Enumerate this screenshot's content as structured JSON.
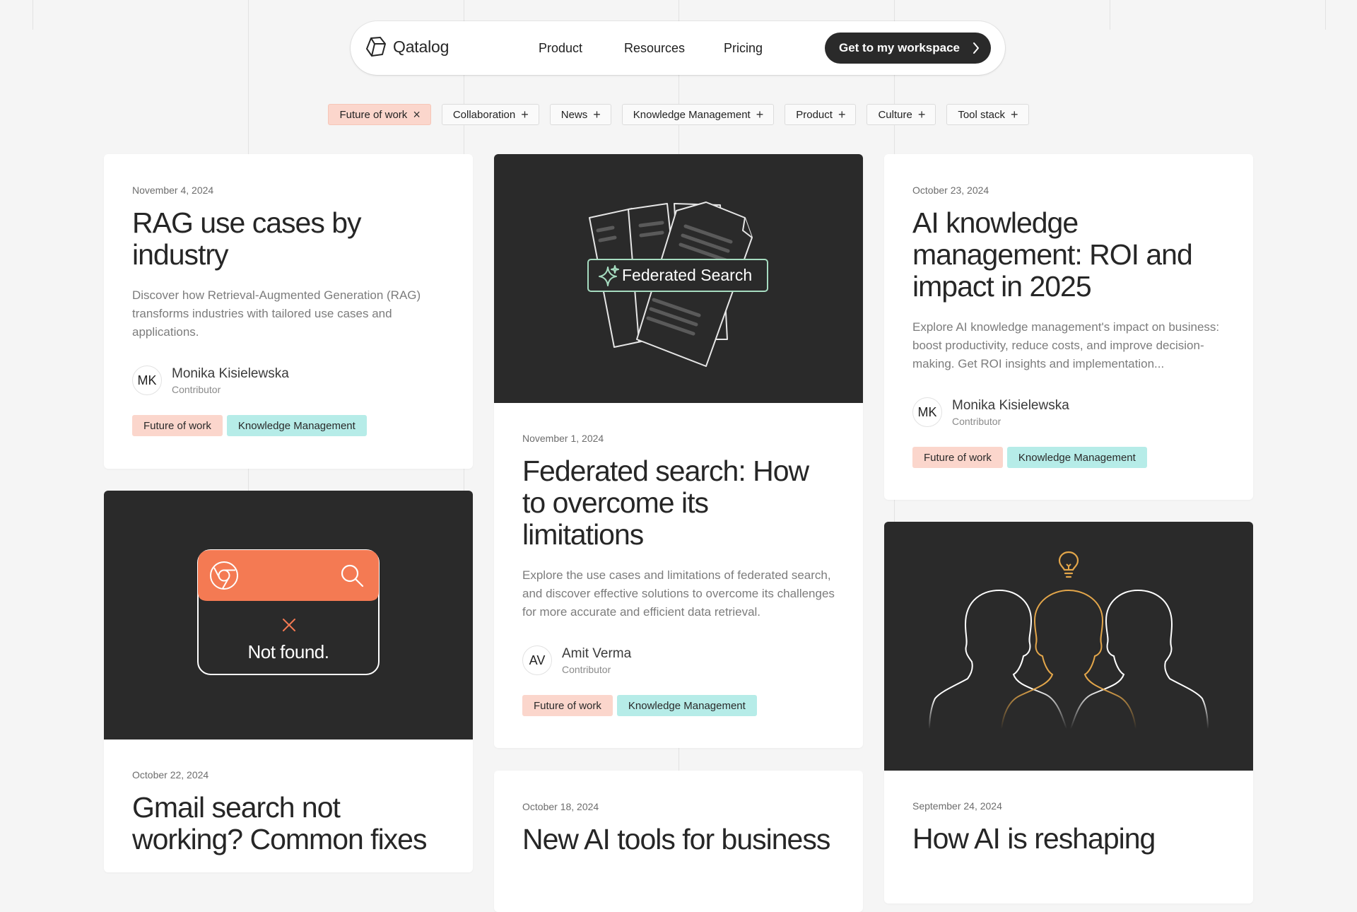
{
  "brand": {
    "name": "Qatalog"
  },
  "nav": {
    "links": [
      "Product",
      "Resources",
      "Pricing"
    ],
    "cta_label": "Get to my workspace"
  },
  "filters": [
    {
      "label": "Future of work",
      "active": true
    },
    {
      "label": "Collaboration",
      "active": false
    },
    {
      "label": "News",
      "active": false
    },
    {
      "label": "Knowledge Management",
      "active": false
    },
    {
      "label": "Product",
      "active": false
    },
    {
      "label": "Culture",
      "active": false
    },
    {
      "label": "Tool stack",
      "active": false
    }
  ],
  "colors": {
    "accent_orange": "#f47a53",
    "tag_orange": "#fbd6cc",
    "tag_teal": "#b6ece8",
    "art_bg": "#2a2a2a",
    "green_outline": "#a6dcc0",
    "gold": "#e3a64a"
  },
  "cards": {
    "rag": {
      "date": "November 4, 2024",
      "title": "RAG use cases by industry",
      "desc": "Discover how Retrieval-Augmented Generation (RAG) transforms industries with tailored use cases and applications.",
      "author_initials": "MK",
      "author_name": "Monika Kisielewska",
      "author_role": "Contributor",
      "tags": [
        "Future of work",
        "Knowledge Management"
      ]
    },
    "federated": {
      "art_label": "Federated Search",
      "date": "November 1, 2024",
      "title": "Federated search: How to overcome its limitations",
      "desc": "Explore the use cases and limitations of federated search, and discover effective solutions to overcome its challenges for more accurate and efficient data retrieval.",
      "author_initials": "AV",
      "author_name": "Amit Verma",
      "author_role": "Contributor",
      "tags": [
        "Future of work",
        "Knowledge Management"
      ]
    },
    "ai_roi": {
      "date": "October 23, 2024",
      "title": "AI knowledge management: ROI and impact in 2025",
      "desc": "Explore AI knowledge management's impact on business: boost productivity, reduce costs, and improve decision-making. Get ROI insights and implementation...",
      "author_initials": "MK",
      "author_name": "Monika Kisielewska",
      "author_role": "Contributor",
      "tags": [
        "Future of work",
        "Knowledge Management"
      ]
    },
    "gmail": {
      "art_label": "Not found.",
      "date": "October 22, 2024",
      "title": "Gmail search not working? Common fixes"
    },
    "new_ai": {
      "date": "October 18, 2024",
      "title": "New AI tools for business"
    },
    "how_ai": {
      "date": "September 24, 2024",
      "title": "How AI is reshaping"
    }
  }
}
